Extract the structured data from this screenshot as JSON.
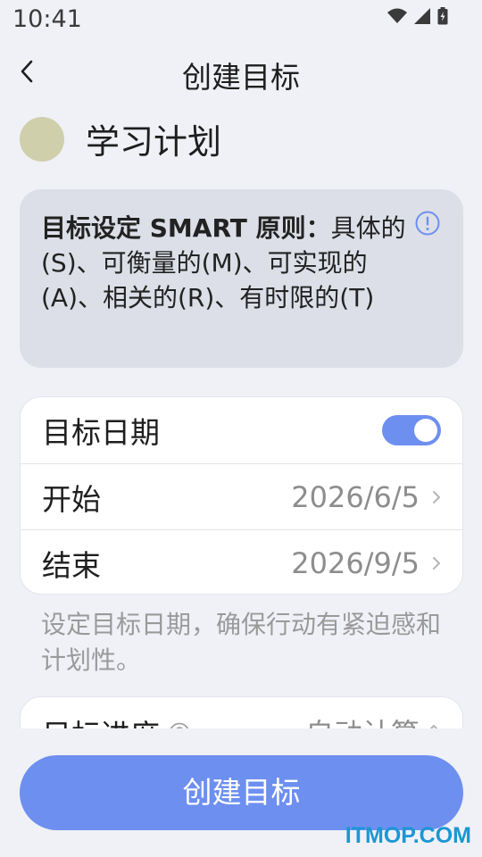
{
  "status_bar": {
    "time": "10:41",
    "icons": [
      "wifi-icon",
      "cellular-signal-icon",
      "battery-icon"
    ]
  },
  "header": {
    "title": "创建目标",
    "back_icon": "chevron-left-icon"
  },
  "plan": {
    "name": "学习计划",
    "avatar_color": "#cfcfab"
  },
  "smart_tip": {
    "bold_text": "目标设定 SMART 原则：",
    "text": "具体的(S)、可衡量的(M)、可实现的(A)、相关的(R)、有时限的(T)",
    "icon": "info-icon"
  },
  "target_date": {
    "label": "目标日期",
    "toggle_on": true,
    "start_label": "开始",
    "start_value": "2026/6/5",
    "end_label": "结束",
    "end_value": "2026/9/5"
  },
  "hint": "设定目标日期，确保行动有紧迫感和计划性。",
  "progress": {
    "label": "目标进度",
    "value": "自动计算",
    "icon": "help-icon"
  },
  "create_button_label": "创建目标",
  "watermark": "ITMOP.COM",
  "colors": {
    "accent": "#6d8ff0",
    "background": "#f0f1f7",
    "tip_background": "#dcdfe7",
    "watermark": "#1b97d4"
  }
}
